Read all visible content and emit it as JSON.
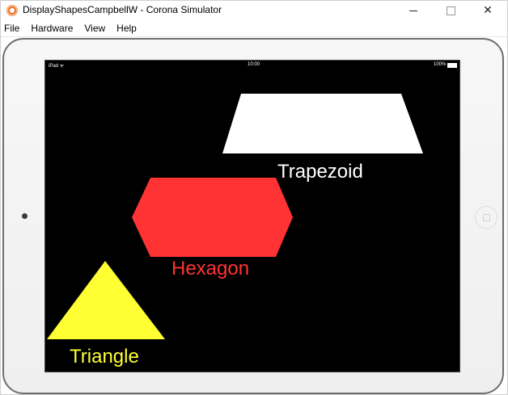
{
  "window": {
    "title": "DisplayShapesCampbellW - Corona Simulator",
    "controls": {
      "minimize": "minimize",
      "maximize": "maximize",
      "close": "✕"
    }
  },
  "menu": {
    "items": [
      "File",
      "Hardware",
      "View",
      "Help"
    ]
  },
  "device": {
    "status_left": "iPad ᯤ",
    "status_time": "10:00",
    "status_right": "100%"
  },
  "shapes": {
    "trapezoid": {
      "label": "Trapezoid",
      "color": "#ffffff"
    },
    "hexagon": {
      "label": "Hexagon",
      "color": "#ff3333"
    },
    "triangle": {
      "label": "Triangle",
      "color": "#ffff33"
    }
  }
}
